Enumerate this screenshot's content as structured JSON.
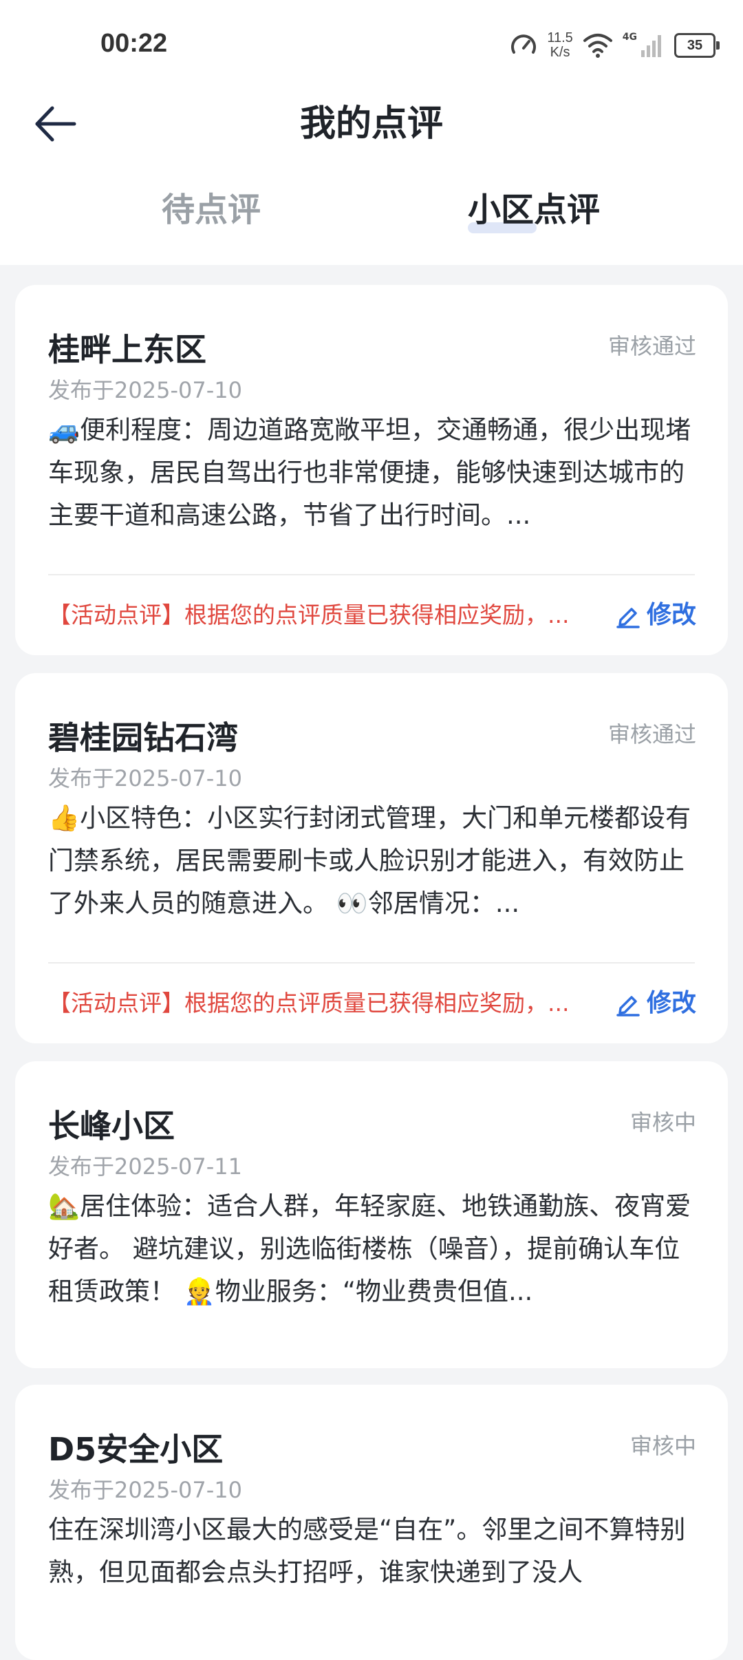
{
  "status_bar": {
    "time": "00:22",
    "net_speed_value": "11.5",
    "net_speed_unit": "K/s",
    "network": "4G",
    "battery": "35"
  },
  "header": {
    "title": "我的点评",
    "back_icon": "arrow-left-icon"
  },
  "tabs": [
    {
      "label": "待点评",
      "active": false
    },
    {
      "label": "小区点评",
      "active": true
    }
  ],
  "reviews": [
    {
      "name": "桂畔上东区",
      "status": "审核通过",
      "date": "发布于2025-07-10",
      "content": "🚙便利程度：周边道路宽敞平坦，交通畅通，很少出现堵车现象，居民自驾出行也非常便捷，能够快速到达城市的主要干道和高速公路，节省了出行时间。...",
      "activity": "【活动点评】根据您的点评质量已获得相应奖励，...",
      "edit_label": "修改"
    },
    {
      "name": "碧桂园钻石湾",
      "status": "审核通过",
      "date": "发布于2025-07-10",
      "content": "👍小区特色：小区实行封闭式管理，大门和单元楼都设有门禁系统，居民需要刷卡或人脸识别才能进入，有效防止了外来人员的随意进入。 👀邻居情况：...",
      "activity": "【活动点评】根据您的点评质量已获得相应奖励，...",
      "edit_label": "修改"
    },
    {
      "name": "长峰小区",
      "status": "审核中",
      "date": "发布于2025-07-11",
      "content": "🏡居住体验：适合人群，年轻家庭、地铁通勤族、夜宵爱好者。 避坑建议，别选临街楼栋（噪音），提前确认车位租赁政策！ 👷物业服务：“物业费贵但值...",
      "activity": "",
      "edit_label": ""
    },
    {
      "name": "D5安全小区",
      "status": "审核中",
      "date": "发布于2025-07-10",
      "content": "住在深圳湾小区最大的感受是“自在”。邻里之间不算特别熟，但见面都会点头打招呼，谁家快递到了没人",
      "activity": "",
      "edit_label": ""
    }
  ],
  "colors": {
    "accent": "#2f6fe0",
    "activity_red": "#e0473e",
    "page_bg": "#f3f4f6"
  }
}
